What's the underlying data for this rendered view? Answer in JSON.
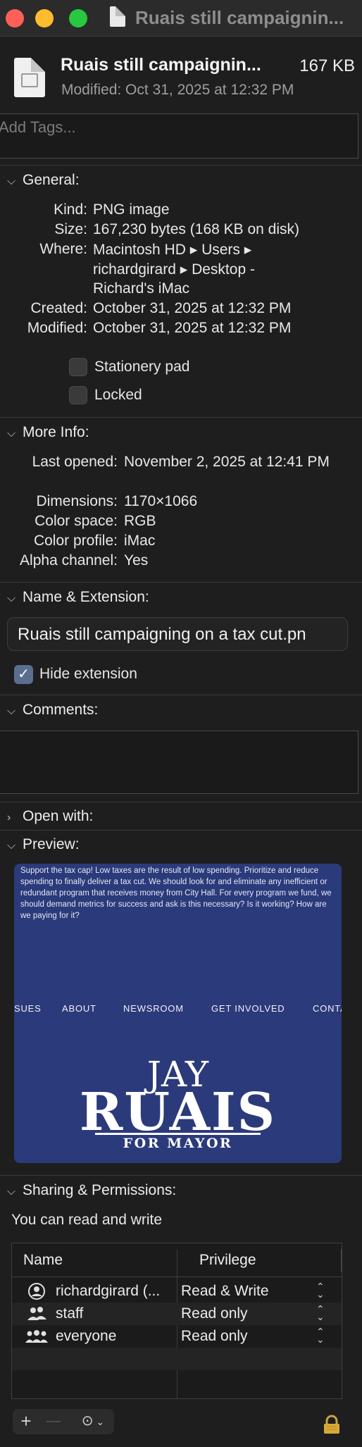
{
  "window": {
    "title": "Ruais still campaignin...",
    "traffic": {
      "close": "#fe5f57",
      "minimize": "#febc2e",
      "zoom": "#28c840"
    }
  },
  "header": {
    "file_name": "Ruais still campaignin...",
    "size": "167 KB",
    "modified": "Modified: Oct 31, 2025 at 12:32 PM",
    "icon": "png-document-icon"
  },
  "tags": {
    "placeholder": "Add Tags..."
  },
  "general": {
    "title": "General:",
    "kind_label": "Kind:",
    "kind": "PNG image",
    "size_label": "Size:",
    "size": "167,230 bytes (168 KB on disk)",
    "where_label": "Where:",
    "where_line1": "Macintosh HD ▸ Users ▸",
    "where_line2": "richardgirard ▸ Desktop -",
    "where_line3": "Richard's iMac",
    "created_label": "Created:",
    "created": "October 31, 2025 at 12:32 PM",
    "modified_label": "Modified:",
    "modified": "October 31, 2025 at 12:32 PM",
    "stationery_label": "Stationery pad",
    "locked_label": "Locked"
  },
  "more_info": {
    "title": "More Info:",
    "last_opened_label": "Last opened:",
    "last_opened": "November 2, 2025 at 12:41 PM",
    "dimensions_label": "Dimensions:",
    "dimensions": "1170×1066",
    "color_space_label": "Color space:",
    "color_space": "RGB",
    "color_profile_label": "Color profile:",
    "color_profile": "iMac",
    "alpha_label": "Alpha channel:",
    "alpha": "Yes"
  },
  "name_ext": {
    "title": "Name & Extension:",
    "value": "Ruais still campaigning on a tax cut.pn",
    "hide_extension_label": "Hide extension",
    "hide_extension_checked": true
  },
  "comments": {
    "title": "Comments:"
  },
  "open_with": {
    "title": "Open with:"
  },
  "preview": {
    "title": "Preview:",
    "body_text": "Support the tax cap! Low taxes are the result of low spending. Prioritize and reduce spending to finally deliver a tax cut. We should look for and eliminate any inefficient or redundant program that receives money from City Hall. For every program we fund, we should demand metrics for success and ask is this necessary? Is it working? How are we paying for it?",
    "nav": [
      "SUES",
      "ABOUT",
      "NEWSROOM",
      "GET INVOLVED",
      "CONTA"
    ],
    "logo_first": "JAY",
    "logo_last": "RUAIS",
    "logo_sub": "FOR MAYOR",
    "bg_color": "#2b3a7a"
  },
  "sharing": {
    "title": "Sharing & Permissions:",
    "status": "You can read and write",
    "col_name": "Name",
    "col_priv": "Privilege",
    "rows": [
      {
        "name": "richardgirard (...",
        "privilege": "Read & Write",
        "icon": "user-icon"
      },
      {
        "name": "staff",
        "privilege": "Read only",
        "icon": "group-icon"
      },
      {
        "name": "everyone",
        "privilege": "Read only",
        "icon": "everyone-icon"
      }
    ],
    "add": "+",
    "remove": "—"
  }
}
